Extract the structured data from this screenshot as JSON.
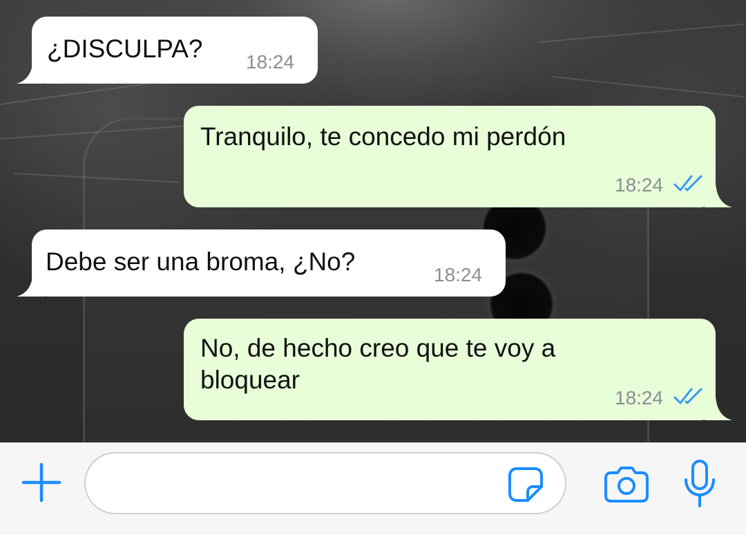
{
  "theme": {
    "incoming_bubble": "#ffffff",
    "outgoing_bubble": "#e7fed8",
    "read_ticks": "#3497f9",
    "accent": "#1a8cff",
    "time_text": "#8d8d92"
  },
  "messages": [
    {
      "direction": "incoming",
      "text": "¿DISCULPA?",
      "time": "18:24"
    },
    {
      "direction": "outgoing",
      "text": "Tranquilo, te concedo mi perdón",
      "time": "18:24",
      "status": "read"
    },
    {
      "direction": "incoming",
      "text": "Debe ser una broma, ¿No?",
      "time": "18:24"
    },
    {
      "direction": "outgoing",
      "text": "No, de hecho creo que te voy a\nbloquear",
      "time": "18:24",
      "status": "read"
    }
  ],
  "input_bar": {
    "message_value": "",
    "icons": {
      "attach": "plus-icon",
      "sticker": "sticker-icon",
      "camera": "camera-icon",
      "mic": "microphone-icon"
    }
  }
}
